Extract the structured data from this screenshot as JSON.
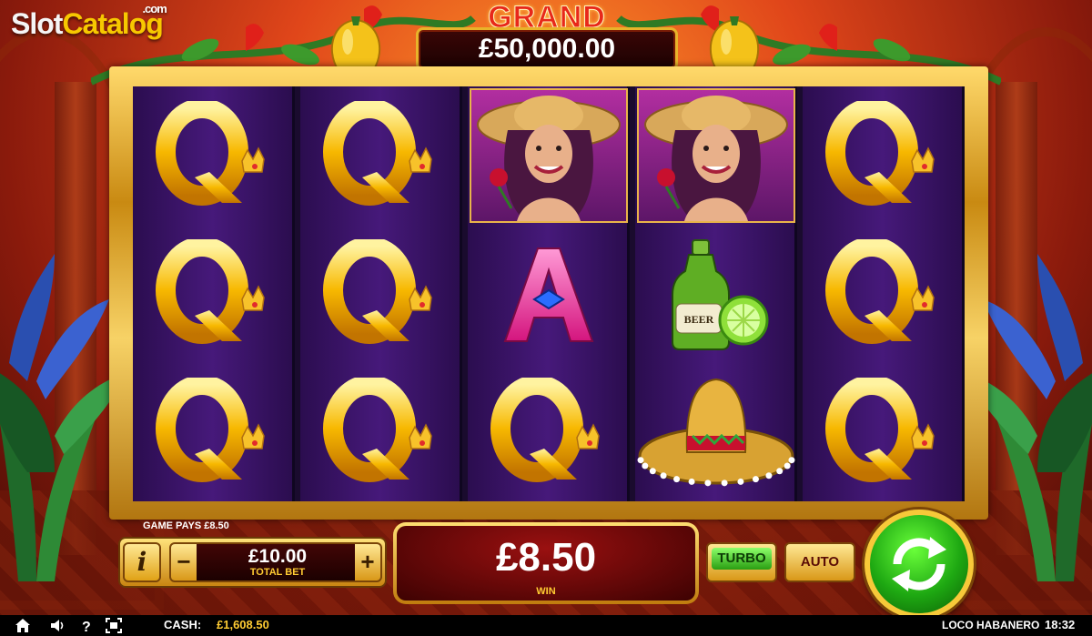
{
  "brand": {
    "logo_part1": "Slot",
    "logo_part2": "Catalog",
    "logo_suffix": ".com"
  },
  "jackpot": {
    "title": "GRAND",
    "value": "£50,000.00"
  },
  "reels": [
    [
      "queen",
      "queen",
      "queen"
    ],
    [
      "queen",
      "queen",
      "queen"
    ],
    [
      "lady",
      "ace",
      "queen"
    ],
    [
      "lady",
      "beer-lime",
      "sombrero"
    ],
    [
      "queen",
      "queen",
      "queen"
    ]
  ],
  "symbol_texts": {
    "beer_label": "BEER"
  },
  "bottom": {
    "game_pays": "GAME PAYS £8.50",
    "info_label": "i",
    "minus_label": "−",
    "plus_label": "+",
    "total_bet_value": "£10.00",
    "total_bet_label": "TOTAL BET",
    "win_value": "£8.50",
    "win_label": "WIN",
    "turbo_label": "TURBO",
    "auto_label": "AUTO"
  },
  "status": {
    "cash_label": "CASH:",
    "cash_value": "£1,608.50",
    "game_name": "LOCO HABANERO",
    "clock": "18:32"
  },
  "colors": {
    "gold": "#f5c02c",
    "reel_purple": "#3d1670",
    "spin_green": "#1ea812",
    "win_red": "#8a0f0f"
  }
}
